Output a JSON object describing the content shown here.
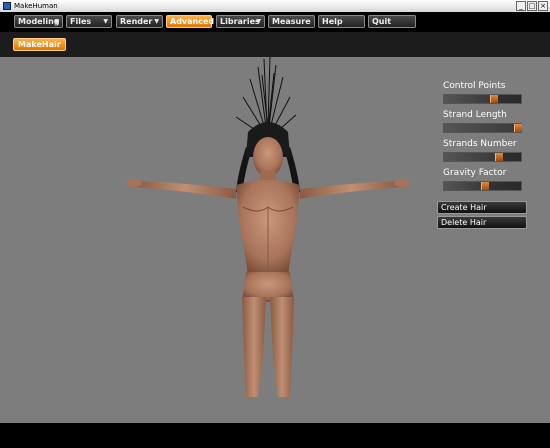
{
  "window": {
    "title": "MakeHuman",
    "controls": [
      "_",
      "□",
      "×"
    ]
  },
  "menubar": {
    "items": [
      {
        "label": "Modeling",
        "dropdown": true
      },
      {
        "label": "Files",
        "dropdown": true
      },
      {
        "label": "Render",
        "dropdown": true
      },
      {
        "label": "Advanced",
        "dropdown": false,
        "active": true
      },
      {
        "label": "Libraries",
        "dropdown": true
      },
      {
        "label": "Measure",
        "dropdown": false
      },
      {
        "label": "Help",
        "dropdown": false
      },
      {
        "label": "Quit",
        "dropdown": false
      }
    ]
  },
  "submenu": {
    "active_tab": "MakeHair"
  },
  "panel": {
    "sliders": [
      {
        "label": "Control Points",
        "value": 0.6
      },
      {
        "label": "Strand Length",
        "value": 0.95
      },
      {
        "label": "Strands Number",
        "value": 0.68
      },
      {
        "label": "Gravity Factor",
        "value": 0.5
      }
    ],
    "buttons": [
      {
        "label": "Create Hair"
      },
      {
        "label": "Delete Hair"
      }
    ]
  },
  "colors": {
    "accent": "#f08a1c",
    "viewport_bg": "#7d7d7d",
    "bar_bg": "#000000"
  }
}
